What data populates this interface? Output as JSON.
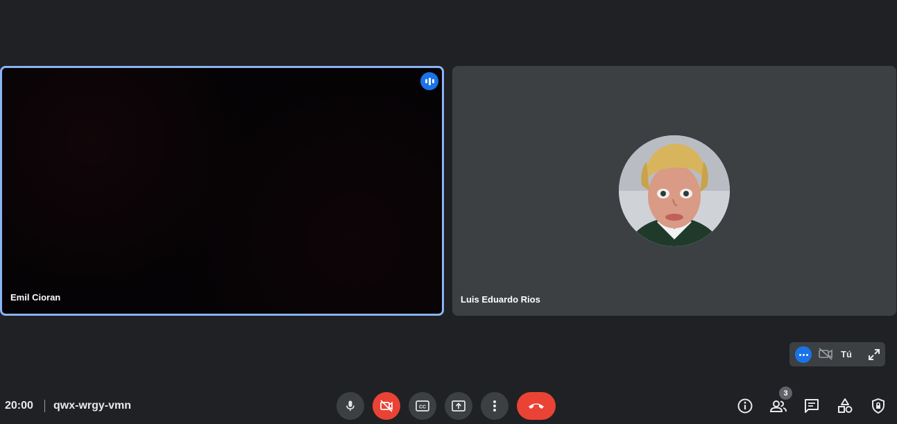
{
  "participants": [
    {
      "name": "Emil Cioran",
      "speaking": true
    },
    {
      "name": "Luis Eduardo Rios",
      "speaking": false
    }
  ],
  "self_view": {
    "label": "Tú"
  },
  "meeting": {
    "time": "20:00",
    "code": "qwx-wrgy-vmn"
  },
  "people_count": "3",
  "colors": {
    "background": "#202124",
    "tile": "#3c4043",
    "accent_blue": "#1a73e8",
    "active_border": "#8ab4f8",
    "danger": "#ea4335"
  },
  "controls": {
    "center": [
      "mic-icon",
      "camera-off-icon",
      "captions-icon",
      "present-screen-icon",
      "more-options-icon",
      "hang-up-icon"
    ],
    "right": [
      "info-icon",
      "people-icon",
      "chat-icon",
      "activities-icon",
      "host-controls-icon"
    ]
  }
}
